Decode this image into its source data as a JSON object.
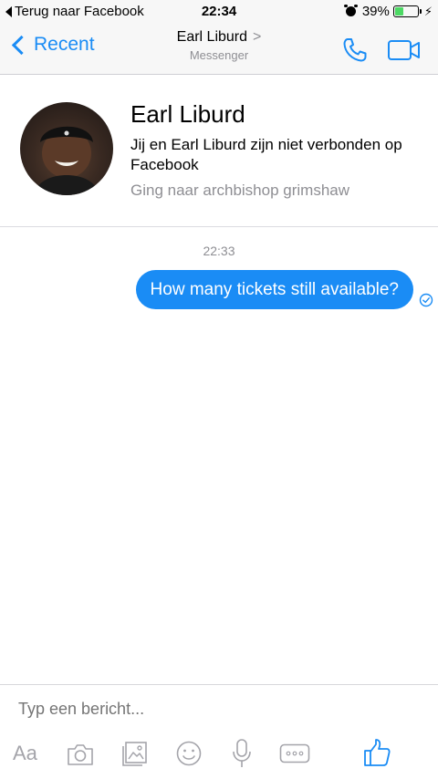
{
  "status_bar": {
    "back_app": "Terug naar Facebook",
    "time": "22:34",
    "battery": "39%",
    "battery_level": 0.39
  },
  "nav": {
    "back_label": "Recent",
    "title": "Earl Liburd",
    "title_arrow": ">",
    "subtitle": "Messenger",
    "icons": [
      "phone-icon",
      "video-camera-icon"
    ]
  },
  "profile": {
    "name": "Earl Liburd",
    "description": "Jij en Earl Liburd zijn niet verbonden op Facebook",
    "location": "Ging naar archbishop grimshaw"
  },
  "conversation": {
    "timestamp": "22:33",
    "messages": [
      {
        "text": "How many tickets still available?",
        "sender": "me",
        "status": "sent"
      }
    ]
  },
  "composer": {
    "placeholder": "Typ een bericht...",
    "text_toggle": "Aa",
    "icons": [
      "camera-icon",
      "gallery-icon",
      "emoji-icon",
      "microphone-icon",
      "more-icon",
      "thumbs-up-icon"
    ]
  },
  "colors": {
    "accent": "#1a8cf5",
    "battery_green": "#4cd964",
    "muted": "#8e8e93",
    "icon_gray": "#a4a4aa"
  }
}
